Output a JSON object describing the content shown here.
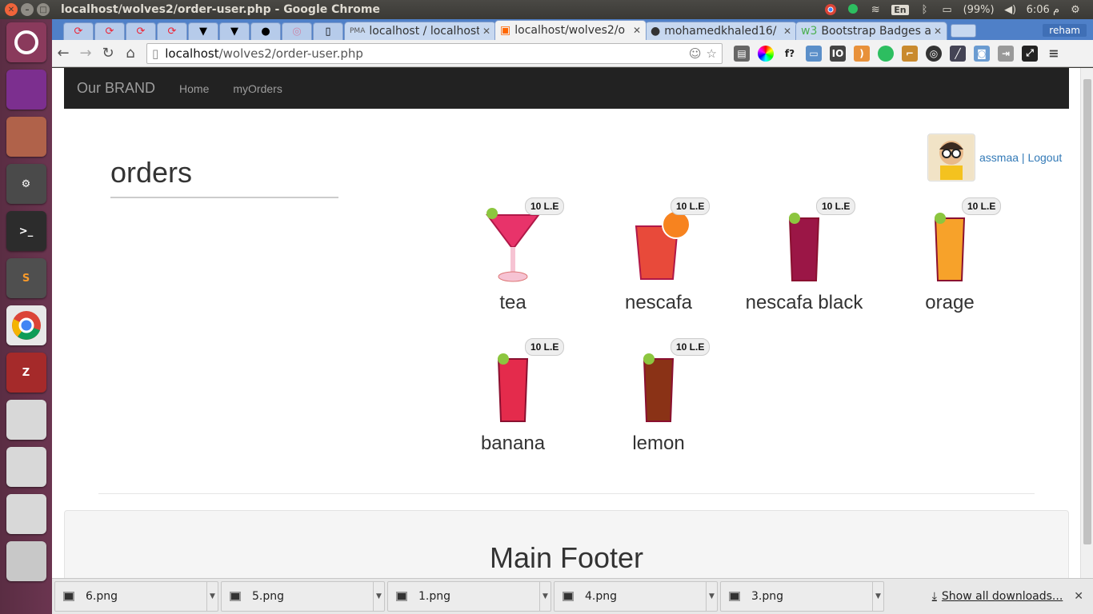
{
  "window": {
    "title": "localhost/wolves2/order-user.php - Google Chrome",
    "tray": {
      "keyboard": "En",
      "battery": "(99%)",
      "time": "6:06 م"
    }
  },
  "browser": {
    "tabs": [
      {
        "label": "localhost / localhost"
      },
      {
        "label": "localhost/wolves2/o"
      },
      {
        "label": "mohamedkhaled16/"
      },
      {
        "label": "Bootstrap Badges ar"
      }
    ],
    "profile": "reham",
    "url": {
      "host": "localhost",
      "path": "/wolves2/order-user.php"
    }
  },
  "site": {
    "brand": "Our BRAND",
    "nav": [
      {
        "label": "Home"
      },
      {
        "label": "myOrders"
      }
    ],
    "user": {
      "name": "assmaa",
      "separator": " | ",
      "logout": "Logout"
    },
    "orders_title": "orders",
    "items": [
      {
        "name": "tea",
        "price": "10 L.E",
        "glass": "martini",
        "color": "#e8336a"
      },
      {
        "name": "nescafa",
        "price": "10 L.E",
        "glass": "tumbler",
        "color": "#e84a3a"
      },
      {
        "name": "nescafa black",
        "price": "10 L.E",
        "glass": "tall",
        "color": "#9b1646"
      },
      {
        "name": "orage",
        "price": "10 L.E",
        "glass": "tall",
        "color": "#f7a22a"
      },
      {
        "name": "banana",
        "price": "10 L.E",
        "glass": "tall",
        "color": "#e42b4c"
      },
      {
        "name": "lemon",
        "price": "10 L.E",
        "glass": "tall",
        "color": "#8a3216"
      }
    ],
    "footer_title": "Main Footer"
  },
  "downloads": {
    "files": [
      "6.png",
      "5.png",
      "1.png",
      "4.png",
      "3.png"
    ],
    "show_all": "Show all downloads..."
  }
}
